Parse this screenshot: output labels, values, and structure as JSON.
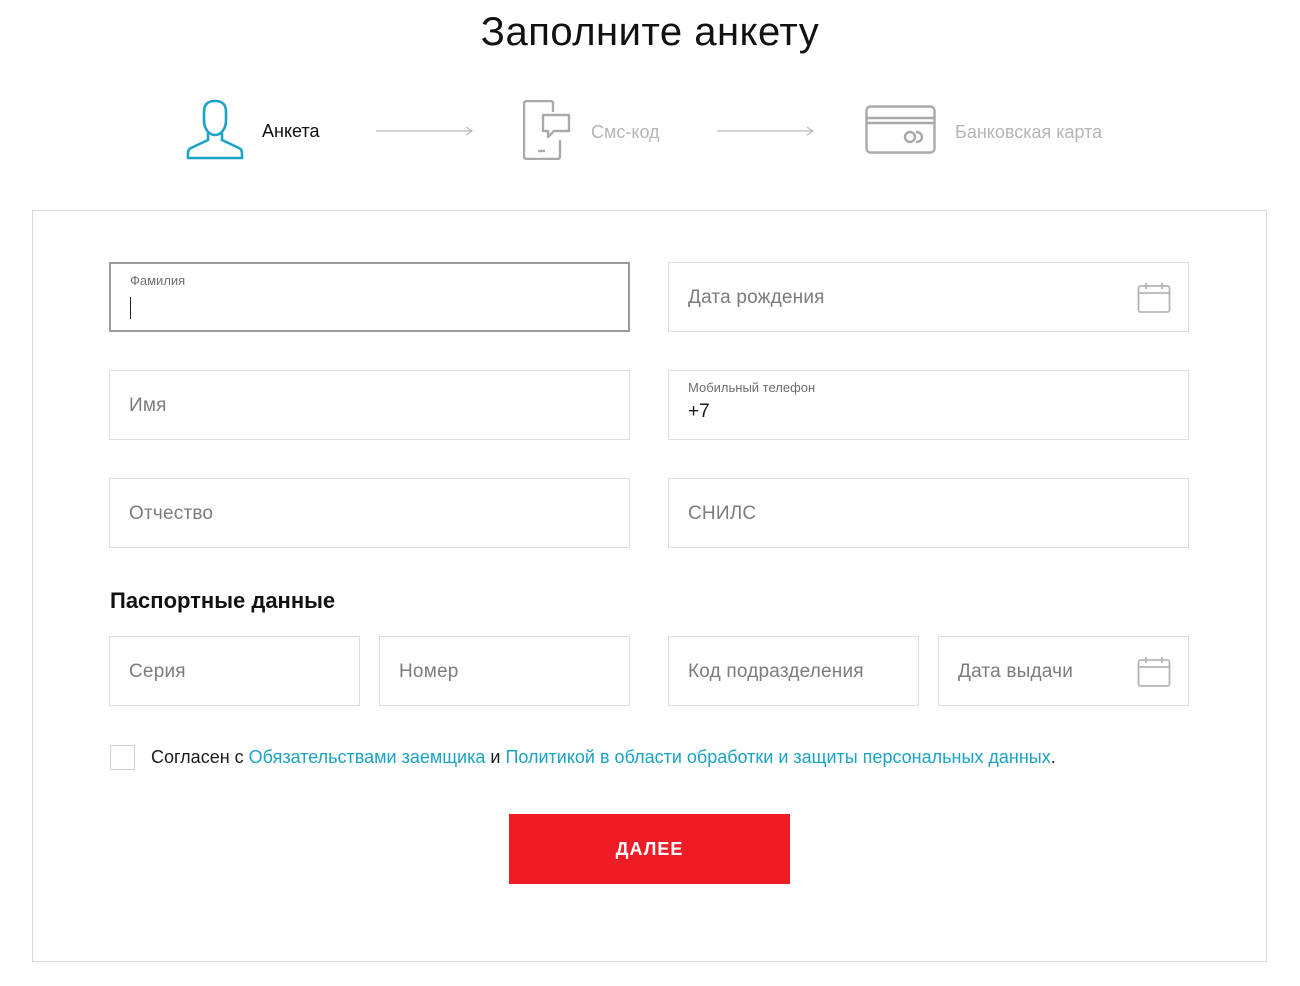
{
  "page": {
    "title": "Заполните анкету"
  },
  "steps": [
    {
      "label": "Анкета",
      "icon": "user-icon",
      "state": "active"
    },
    {
      "label": "Смс-код",
      "icon": "phone-sms-icon",
      "state": "inactive"
    },
    {
      "label": "Банковская карта",
      "icon": "bank-card-icon",
      "state": "inactive"
    }
  ],
  "form": {
    "last_name": {
      "label": "Фамилия",
      "value": ""
    },
    "birth_date": {
      "placeholder": "Дата рождения"
    },
    "first_name": {
      "placeholder": "Имя"
    },
    "mobile_phone": {
      "label": "Мобильный телефон",
      "value": "+7"
    },
    "patronymic": {
      "placeholder": "Отчество"
    },
    "snils": {
      "placeholder": "СНИЛС"
    }
  },
  "passport": {
    "title": "Паспортные данные",
    "series": {
      "placeholder": "Серия"
    },
    "number": {
      "placeholder": "Номер"
    },
    "division_code": {
      "placeholder": "Код подразделения"
    },
    "issue_date": {
      "placeholder": "Дата выдачи"
    }
  },
  "consent": {
    "prefix": "Согласен с ",
    "link1": "Обязательствами заемщика",
    "middle": " и ",
    "link2": "Политикой в области обработки и защиты персональных данных",
    "suffix": ".",
    "checked": false
  },
  "actions": {
    "next_label": "ДАЛЕЕ"
  },
  "colors": {
    "accent": "#1aa3c4",
    "button": "#ee1c25",
    "inactive_icon": "#a9a9a9"
  }
}
